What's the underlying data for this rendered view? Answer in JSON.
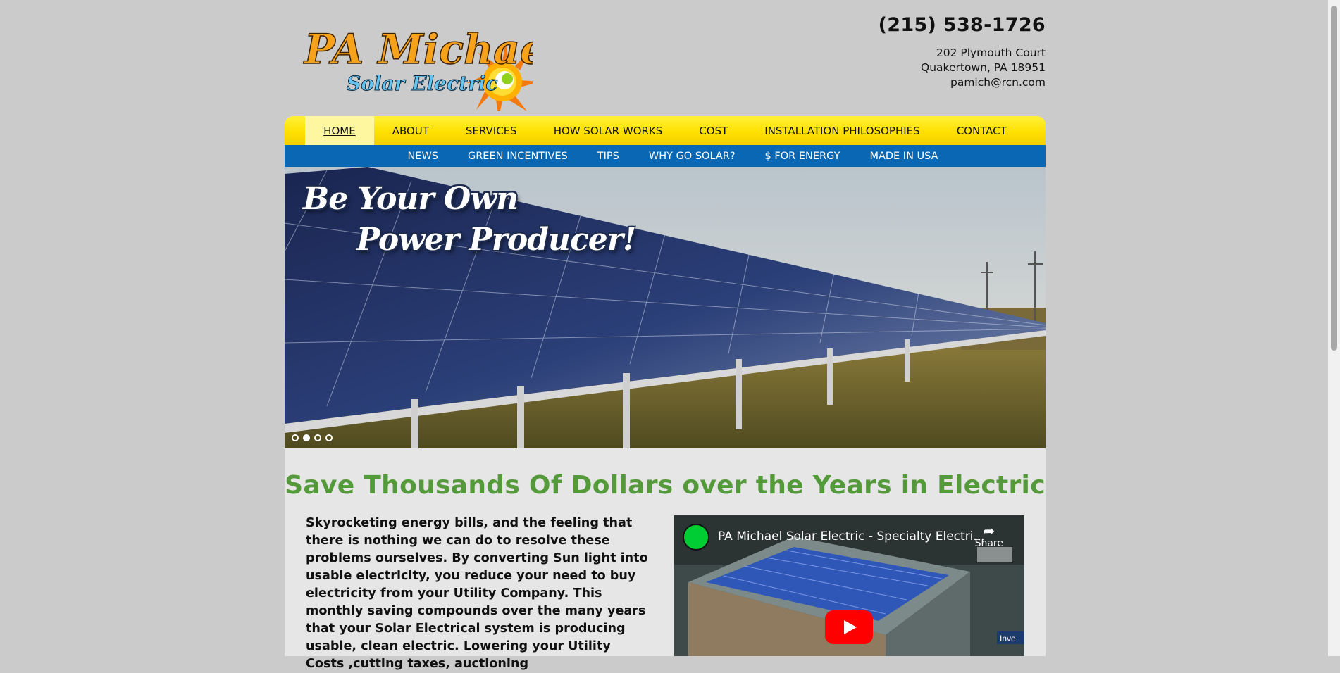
{
  "logo": {
    "line1": "PA Michael",
    "line2": "Solar Electric"
  },
  "contact": {
    "phone": "(215) 538-1726",
    "street": "202 Plymouth Court",
    "city": "Quakertown, PA 18951",
    "email": "pamich@rcn.com"
  },
  "nav_primary": [
    {
      "label": "HOME",
      "active": true
    },
    {
      "label": "ABOUT"
    },
    {
      "label": "SERVICES"
    },
    {
      "label": "HOW SOLAR WORKS"
    },
    {
      "label": "COST"
    },
    {
      "label": "INSTALLATION PHILOSOPHIES"
    },
    {
      "label": "CONTACT"
    }
  ],
  "nav_secondary": [
    {
      "label": "NEWS"
    },
    {
      "label": "GREEN INCENTIVES"
    },
    {
      "label": "TIPS"
    },
    {
      "label": "WHY GO SOLAR?"
    },
    {
      "label": "$ FOR ENERGY"
    },
    {
      "label": "MADE IN USA"
    }
  ],
  "hero": {
    "headline_line1": "Be Your Own",
    "headline_line2": "Power Producer!",
    "slide_count": 4,
    "active_slide_index": 1
  },
  "main": {
    "title": "Save Thousands Of Dollars over the Years in Electric",
    "body": "Skyrocketing energy bills, and the feeling that there is nothing we can do to resolve these problems ourselves. By converting Sun light into usable electricity, you reduce your need to buy electricity from your Utility Company. This monthly saving compounds over the many years that your Solar Electrical system is producing usable, clean electric. Lowering your Utility Costs ,cutting taxes, auctioning"
  },
  "video": {
    "title": "PA Michael Solar Electric - Specialty Electri...",
    "share_label": "Share",
    "inset_label": "Inve"
  },
  "colors": {
    "nav_yellow": "#ffe000",
    "nav_blue": "#0a67b3",
    "title_green": "#54993a",
    "page_bg": "#cbcbcb",
    "content_bg": "#e6e6e6"
  }
}
